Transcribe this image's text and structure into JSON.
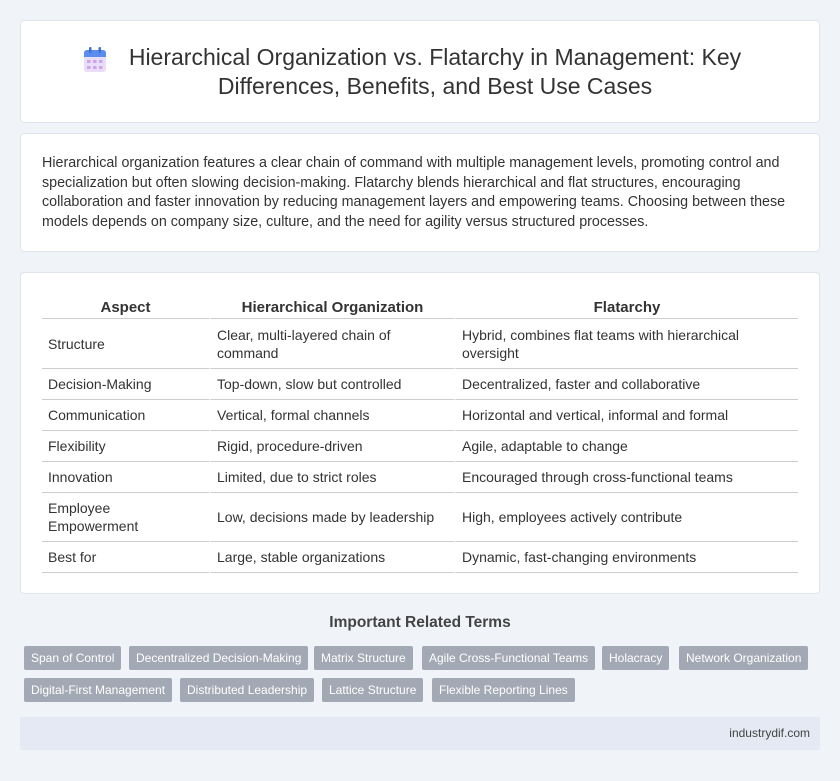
{
  "header": {
    "title": "Hierarchical Organization vs. Flatarchy in Management: Key Differences, Benefits, and Best Use Cases",
    "icon": "calendar-icon",
    "icon_colors": {
      "top": "#5b8def",
      "grid": "#c9a7e8"
    }
  },
  "intro": {
    "text": "Hierarchical organization features a clear chain of command with multiple management levels, promoting control and specialization but often slowing decision-making. Flatarchy blends hierarchical and flat structures, encouraging collaboration and faster innovation by reducing management layers and empowering teams. Choosing between these models depends on company size, culture, and the need for agility versus structured processes."
  },
  "table": {
    "headers": [
      "Aspect",
      "Hierarchical Organization",
      "Flatarchy"
    ],
    "rows": [
      [
        "Structure",
        "Clear, multi-layered chain of command",
        "Hybrid, combines flat teams with hierarchical oversight"
      ],
      [
        "Decision-Making",
        "Top-down, slow but controlled",
        "Decentralized, faster and collaborative"
      ],
      [
        "Communication",
        "Vertical, formal channels",
        "Horizontal and vertical, informal and formal"
      ],
      [
        "Flexibility",
        "Rigid, procedure-driven",
        "Agile, adaptable to change"
      ],
      [
        "Innovation",
        "Limited, due to strict roles",
        "Encouraged through cross-functional teams"
      ],
      [
        "Employee Empowerment",
        "Low, decisions made by leadership",
        "High, employees actively contribute"
      ],
      [
        "Best for",
        "Large, stable organizations",
        "Dynamic, fast-changing environments"
      ]
    ]
  },
  "related": {
    "title": "Important Related Terms",
    "tags": [
      "Span of Control",
      "Decentralized Decision-Making",
      "Matrix Structure",
      "Agile Cross-Functional Teams",
      "Holacracy",
      "Network Organization",
      "Digital-First Management",
      "Distributed Leadership",
      "Lattice Structure",
      "Flexible Reporting Lines"
    ]
  },
  "footer": {
    "site": "industrydif.com"
  },
  "colors": {
    "tag_bg": "#a3a9b4",
    "page_bg": "#f0f3f8",
    "footer_bg": "#e4e9f4"
  }
}
